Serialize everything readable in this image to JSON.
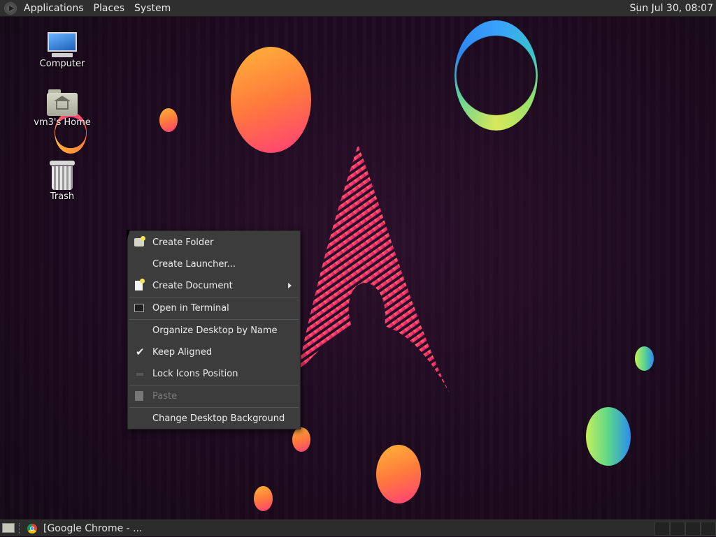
{
  "top_panel": {
    "menus": [
      "Applications",
      "Places",
      "System"
    ],
    "clock": "Sun Jul 30, 08:07"
  },
  "desktop_icons": [
    {
      "label": "Computer",
      "icon": "computer-icon"
    },
    {
      "label": "vm3's Home",
      "icon": "home-folder-icon"
    },
    {
      "label": "Trash",
      "icon": "trash-icon"
    }
  ],
  "context_menu": {
    "items": [
      {
        "label": "Create Folder",
        "icon": "folder-new-icon"
      },
      {
        "label": "Create Launcher...",
        "icon": ""
      },
      {
        "label": "Create Document",
        "icon": "document-new-icon",
        "submenu": true
      },
      {
        "label": "Open in Terminal",
        "icon": "terminal-icon"
      },
      {
        "label": "Organize Desktop by Name",
        "icon": ""
      },
      {
        "label": "Keep Aligned",
        "icon": "check-icon",
        "checked": true
      },
      {
        "label": "Lock Icons Position",
        "icon": "lock-icon"
      },
      {
        "label": "Paste",
        "icon": "paste-icon",
        "disabled": true
      },
      {
        "label": "Change Desktop Background",
        "icon": ""
      }
    ]
  },
  "bottom_panel": {
    "task_label": "[Google Chrome - ..."
  },
  "colors": {
    "panel": "#2f2f2f",
    "menu_bg": "#3c3c3c",
    "accent_warm": "#ff7a3c",
    "accent_pink": "#ff3d7a",
    "accent_cool": "#2b8cf0"
  }
}
